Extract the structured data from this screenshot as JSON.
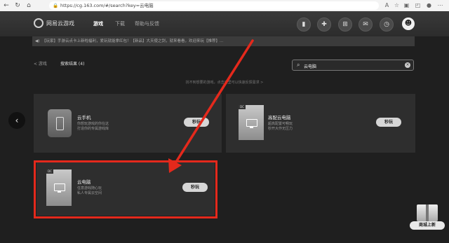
{
  "browser": {
    "url": "https://cg.163.com/#/search?key=云电脑"
  },
  "header": {
    "logo_text": "网易云游戏",
    "nav": [
      "游戏",
      "下载",
      "帮助与反馈"
    ]
  },
  "announcement": {
    "text": "【玩家】手游云点卡上新啦福利，爱玩就能拿红包！【新品】大天使之剑，就来看看，欢迎来玩【推荐】..."
  },
  "search_section": {
    "back_label": "< 游戏",
    "results_label": "搜索结果 (4)",
    "query": "云电脑"
  },
  "hint_text": "找不到想要的游戏，点击这里可以快速反馈需求 >",
  "cards": [
    {
      "title": "云手机",
      "desc": [
        "你想玩游戏的你在这",
        "打造你的专属游戏库"
      ],
      "button": "秒玩",
      "type": "phone"
    },
    {
      "title": "高配云电脑",
      "desc": [
        "超高配置可畅玩",
        "秒开大作无压力"
      ],
      "button": "秒玩",
      "type": "pc",
      "tag": "DC"
    },
    {
      "title": "云电脑",
      "desc": [
        "任意游戏随心玩",
        "私人专属云空间"
      ],
      "button": "秒玩",
      "type": "pc",
      "tag": "DC"
    }
  ],
  "promo": {
    "text": "商城上新"
  },
  "colors": {
    "highlight": "#e4291c"
  }
}
